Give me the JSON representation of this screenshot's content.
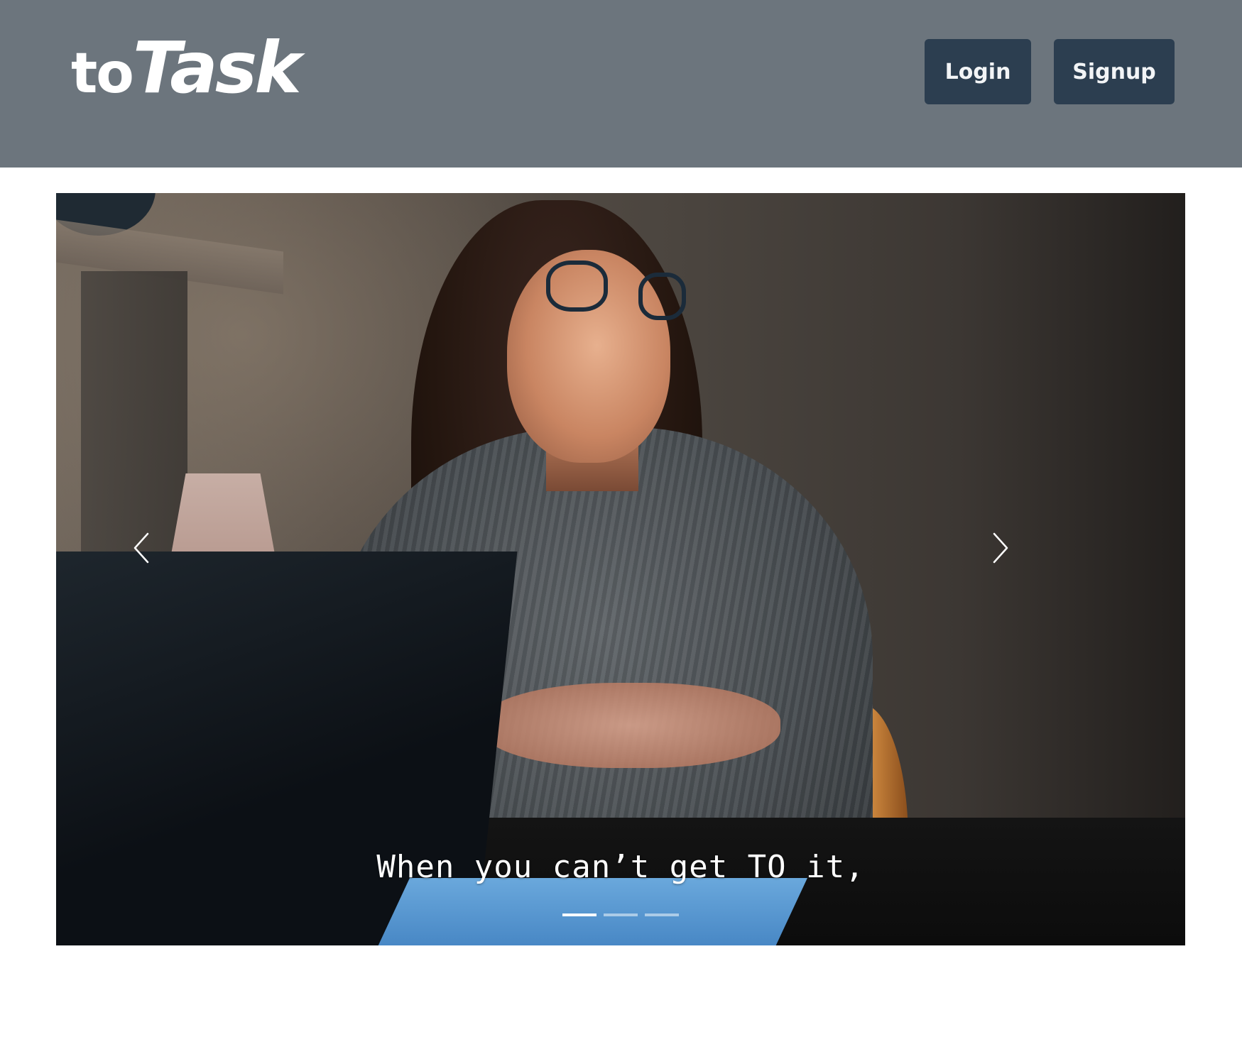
{
  "navbar": {
    "brand_prefix": "to",
    "brand_main": "Task",
    "login_label": "Login",
    "signup_label": "Signup",
    "background_color": "#6c757d",
    "button_color": "#2c3e50"
  },
  "carousel": {
    "caption": "When you can’t get TO it,",
    "prev_icon": "chevron-left-icon",
    "next_icon": "chevron-right-icon",
    "slide_count": 3,
    "active_slide": 1
  }
}
